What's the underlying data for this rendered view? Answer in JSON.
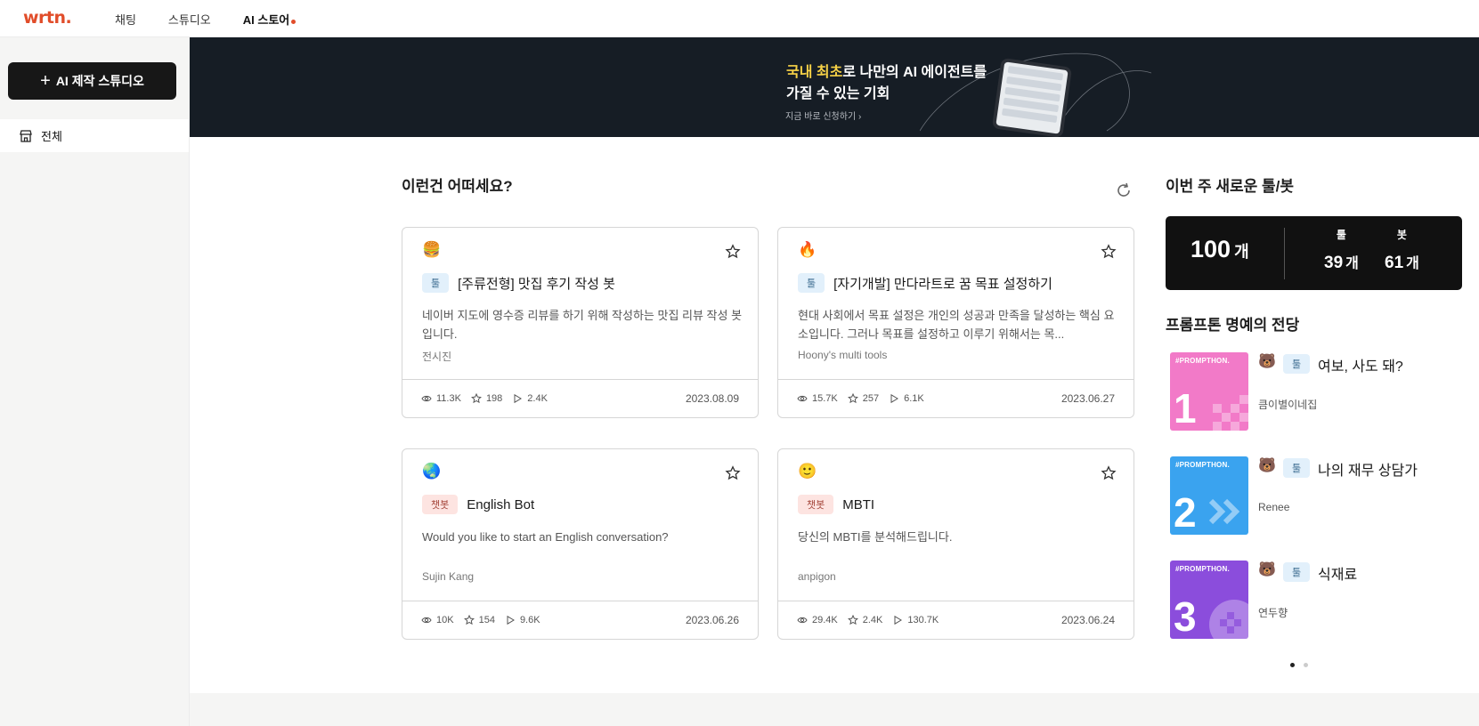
{
  "brand": {
    "logo_text": "wrtn.",
    "accent": "#e14d2a"
  },
  "nav": {
    "items": [
      {
        "label": "채팅"
      },
      {
        "label": "스튜디오"
      },
      {
        "label": "AI 스토어"
      }
    ]
  },
  "sidebar": {
    "create_button": "AI 제작 스튜디오",
    "items": [
      {
        "label": "전체",
        "icon": "store-icon"
      }
    ]
  },
  "banner": {
    "line1_highlight": "국내 최초",
    "line1_rest": "로 나만의 AI 에이전트를",
    "line2": "가질 수 있는 기회",
    "cta": "지금 바로 신청하기"
  },
  "recommend": {
    "title": "이런건 어떠세요?",
    "cards": [
      {
        "emoji": "🍔",
        "tag": "툴",
        "tag_type": "tool",
        "title": "[주류전형] 맛집 후기 작성 봇",
        "desc": "네이버 지도에 영수증 리뷰를 하기 위해 작성하는 맛집 리뷰 작성 봇입니다.",
        "author": "전시진",
        "views": "11.3K",
        "stars": "198",
        "plays": "2.4K",
        "date": "2023.08.09"
      },
      {
        "emoji": "🔥",
        "tag": "툴",
        "tag_type": "tool",
        "title": "[자기개발] 만다라트로 꿈 목표 설정하기",
        "desc": "현대 사회에서 목표 설정은 개인의 성공과 만족을 달성하는 핵심 요소입니다. 그러나 목표를 설정하고 이루기 위해서는 목...",
        "author": "Hoony's multi tools",
        "views": "15.7K",
        "stars": "257",
        "plays": "6.1K",
        "date": "2023.06.27"
      },
      {
        "emoji": "🌏",
        "tag": "챗봇",
        "tag_type": "bot",
        "title": "English Bot",
        "desc": "Would you like to start an English conversation?",
        "author": "Sujin Kang",
        "views": "10K",
        "stars": "154",
        "plays": "9.6K",
        "date": "2023.06.26"
      },
      {
        "emoji": "🙂",
        "tag": "챗봇",
        "tag_type": "bot",
        "title": "MBTI",
        "desc": "당신의 MBTI를 분석해드립니다.",
        "author": "anpigon",
        "views": "29.4K",
        "stars": "2.4K",
        "plays": "130.7K",
        "date": "2023.06.24"
      }
    ]
  },
  "weekly": {
    "title": "이번 주 새로운 툴/봇",
    "total": "100",
    "unit": "개",
    "tool_label": "툴",
    "tool_count": "39",
    "bot_label": "봇",
    "bot_count": "61"
  },
  "hall_of_fame": {
    "title": "프롬프톤 명예의 전당",
    "brand": "#PROMPTHON.",
    "items": [
      {
        "rank": "1",
        "emoji": "🐻",
        "tag": "툴",
        "title": "여보, 사도 돼?",
        "author": "큼이별이네집",
        "color": "#f27ac8"
      },
      {
        "rank": "2",
        "emoji": "🐻",
        "tag": "툴",
        "title": "나의 재무 상담가",
        "author": "Renee",
        "color": "#3aa3ef"
      },
      {
        "rank": "3",
        "emoji": "🐻",
        "tag": "툴",
        "title": "식재료",
        "author": "연두향",
        "color": "#8b4ddc"
      }
    ]
  }
}
